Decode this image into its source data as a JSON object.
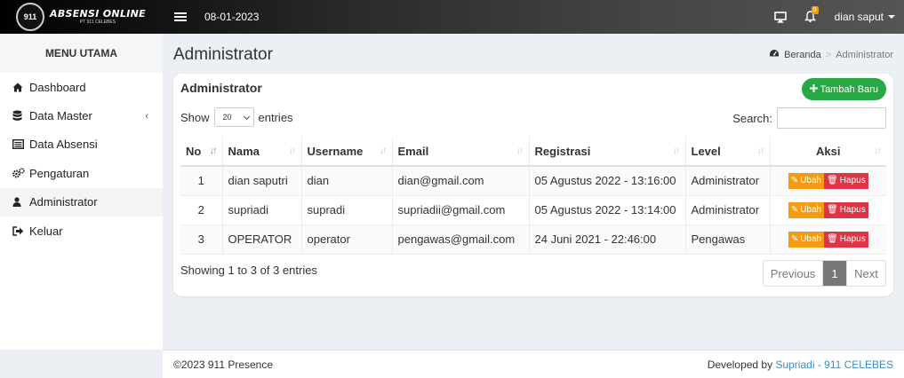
{
  "header": {
    "logo_title": "ABSENSI ONLINE",
    "logo_subtitle": "PT 911 CELEBES",
    "logo_emblem": "911",
    "date": "08-01-2023",
    "notification_count": "9",
    "user_name": "dian saput",
    "icons": [
      "hamburger-icon",
      "monitor-icon",
      "bell-icon",
      "caret-down-icon"
    ]
  },
  "sidebar": {
    "title": "MENU UTAMA",
    "items": [
      {
        "label": "Dashboard",
        "icon": "home-icon"
      },
      {
        "label": "Data Master",
        "icon": "database-icon"
      },
      {
        "label": "Data Absensi",
        "icon": "list-icon"
      },
      {
        "label": "Pengaturan",
        "icon": "gears-icon"
      },
      {
        "label": "Administrator",
        "icon": "user-icon",
        "active": true
      },
      {
        "label": "Keluar",
        "icon": "sign-out-icon"
      }
    ]
  },
  "page": {
    "title": "Administrator",
    "breadcrumb": {
      "home": "Beranda",
      "current": "Administrator"
    }
  },
  "card": {
    "title": "Administrator",
    "add_button": "Tambah Baru",
    "show_label": "Show",
    "entries_value": "20",
    "entries_label": "entries",
    "search_label": "Search:",
    "search_value": ""
  },
  "table": {
    "columns": [
      "No",
      "Nama",
      "Username",
      "Email",
      "Registrasi",
      "Level",
      "Aksi"
    ],
    "rows": [
      {
        "no": "1",
        "nama": "dian saputri",
        "username": "dian",
        "email": "dian@gmail.com",
        "registrasi": "05 Agustus 2022 - 13:16:00",
        "level": "Administrator"
      },
      {
        "no": "2",
        "nama": "supriadi",
        "username": "supradi",
        "email": "supriadii@gmail.com",
        "registrasi": "05 Agustus 2022 - 13:14:00",
        "level": "Administrator"
      },
      {
        "no": "3",
        "nama": "OPERATOR",
        "username": "operator",
        "email": "pengawas@gmail.com",
        "registrasi": "24 Juni 2021 - 22:46:00",
        "level": "Pengawas"
      }
    ],
    "edit_label": "Ubah",
    "delete_label": "Hapus"
  },
  "pagination": {
    "info": "Showing 1 to 3 of 3 entries",
    "previous": "Previous",
    "current_page": "1",
    "next": "Next"
  },
  "footer": {
    "copyright": "©2023 911 Presence",
    "developed_by": "Developed by",
    "author": "Supriadi",
    "separator": "-",
    "company": "911 CELEBES"
  },
  "colors": {
    "add_button": "#28a745",
    "edit_button": "#f39c12",
    "delete_button": "#dc3545",
    "active_page": "#777777",
    "link": "#3c8dbc"
  }
}
